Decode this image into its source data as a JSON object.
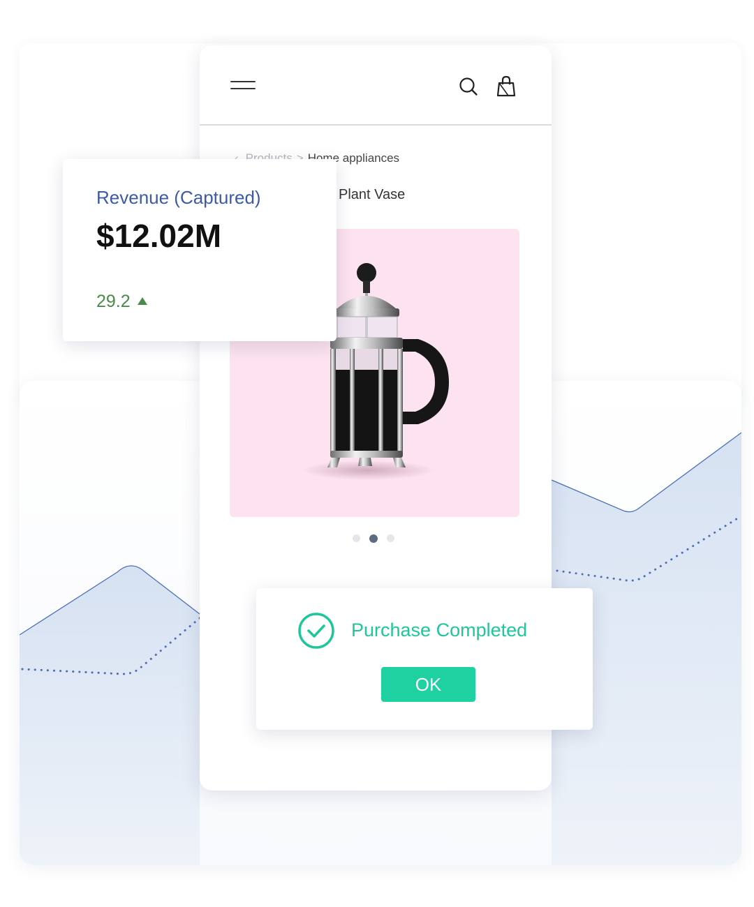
{
  "header": {
    "menu_icon": "hamburger-menu-icon",
    "search_icon": "search-icon",
    "cart_icon": "shopping-bag-icon"
  },
  "breadcrumb": {
    "back_glyph": "‹",
    "parent": "Products",
    "separator": ">",
    "current": "Home appliances"
  },
  "product": {
    "title": "Plant Vase",
    "image_subject": "french-press-icon",
    "image_background": "#fde2ef",
    "carousel": {
      "count": 3,
      "active_index": 1
    }
  },
  "revenue": {
    "label": "Revenue (Captured)",
    "value": "$12.02M",
    "change": "29.2",
    "trend": "up",
    "label_color": "#3b5aa8",
    "change_color": "#4a8a4a"
  },
  "dialog": {
    "message": "Purchase Completed",
    "ok_label": "OK",
    "icon": "check-circle-icon",
    "accent_color": "#1ec79a"
  },
  "background_chart": {
    "area_color": "#dce6f3",
    "line_color": "#4b6fb5",
    "dotted_color": "#4b6fb5"
  }
}
